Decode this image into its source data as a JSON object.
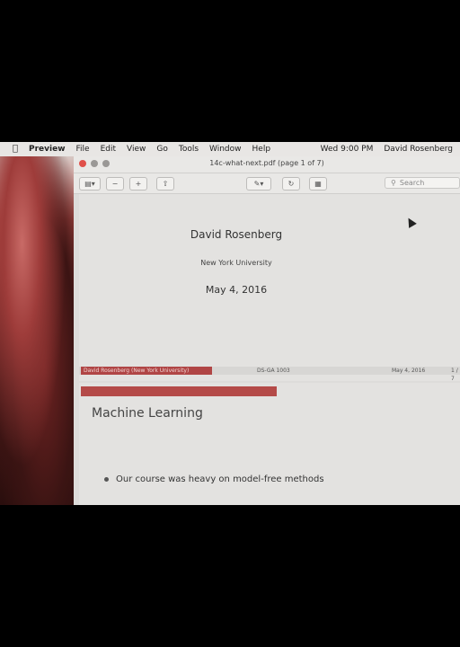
{
  "menubar": {
    "app": "Preview",
    "items": [
      "File",
      "Edit",
      "View",
      "Go",
      "Tools",
      "Window",
      "Help"
    ],
    "clock": "Wed 9:00 PM",
    "user": "David Rosenberg"
  },
  "window": {
    "title": "14c-what-next.pdf (page 1 of 7)",
    "search_placeholder": "Search"
  },
  "slide1": {
    "author": "David Rosenberg",
    "institution": "New York University",
    "date": "May 4, 2016",
    "footer": {
      "left": "David Rosenberg (New York University)",
      "center": "DS-GA 1003",
      "date": "May 4, 2016",
      "page": "1 / 7"
    }
  },
  "slide2": {
    "heading": "Machine Learning",
    "bullet": "Our course was heavy on model-free methods",
    "progress_fraction": 0.5
  },
  "colors": {
    "accent": "#b44a48",
    "close_light": "#e0504a"
  }
}
